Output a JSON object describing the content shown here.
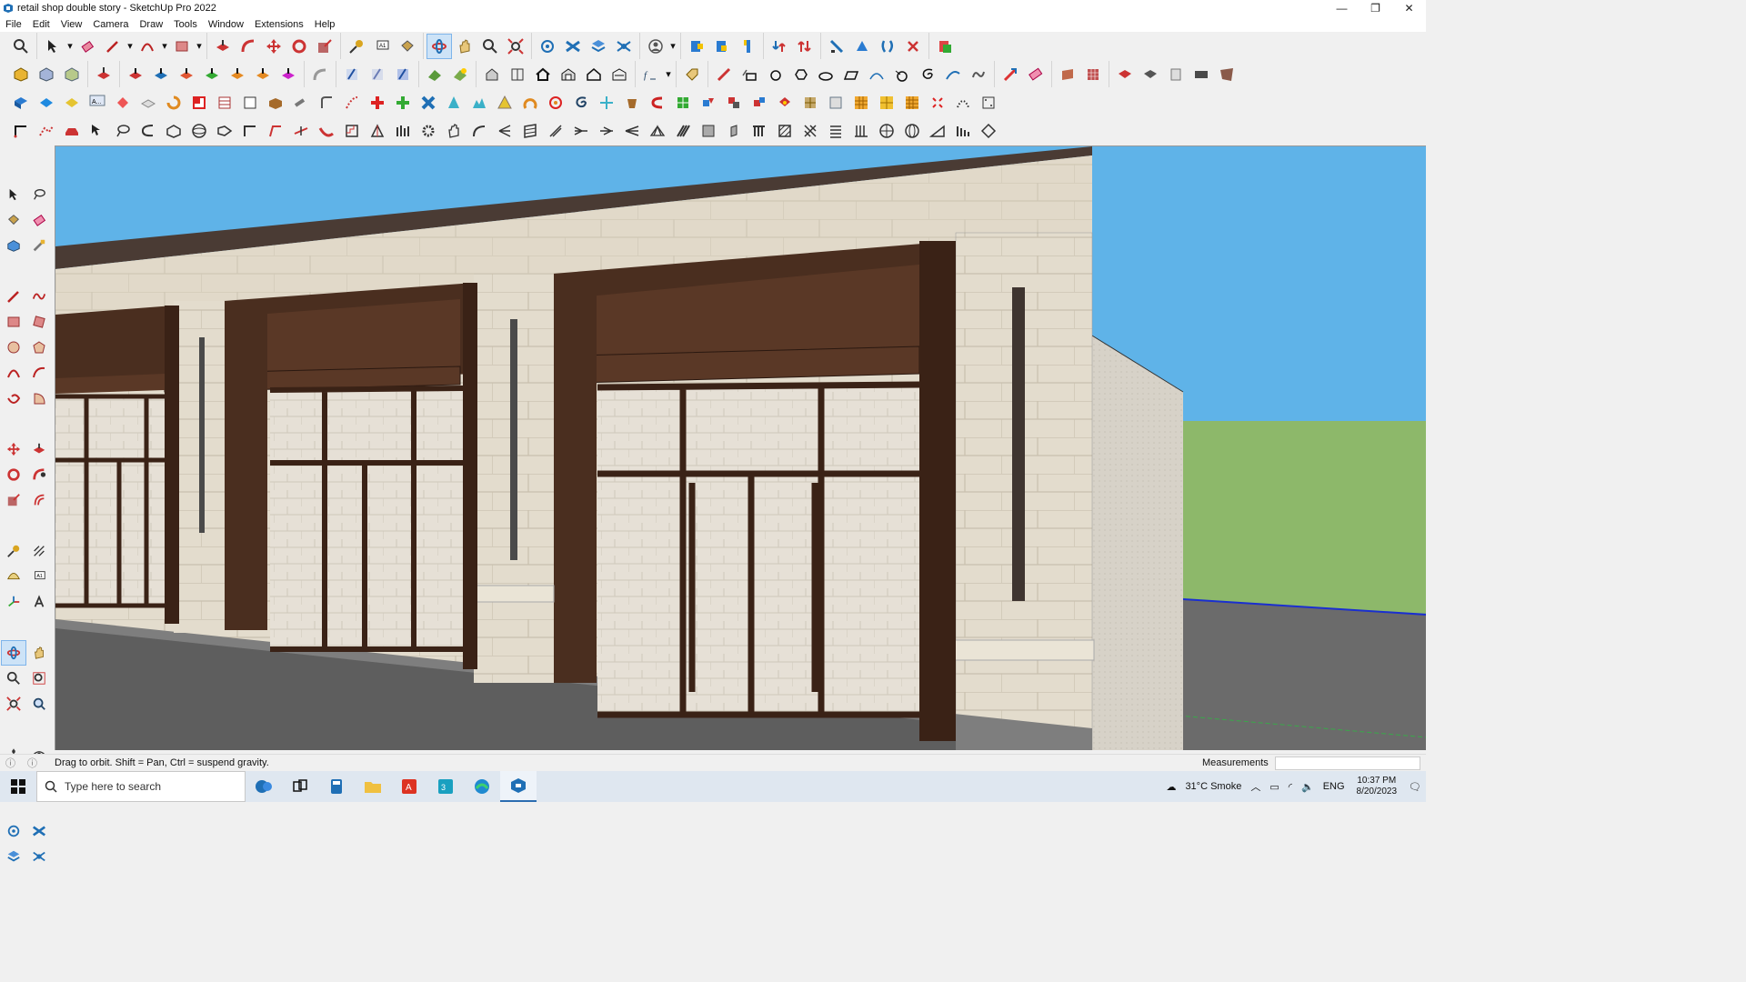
{
  "window": {
    "title": "retail shop double story - SketchUp Pro 2022",
    "minimize": "—",
    "restore": "❐",
    "close": "✕"
  },
  "menu": [
    "File",
    "Edit",
    "View",
    "Camera",
    "Draw",
    "Tools",
    "Window",
    "Extensions",
    "Help"
  ],
  "status": {
    "hint": "Drag to orbit. Shift = Pan, Ctrl = suspend gravity.",
    "measurements_label": "Measurements",
    "measurements_value": ""
  },
  "taskbar": {
    "search_placeholder": "Type here to search",
    "weather": "31°C  Smoke",
    "language": "ENG",
    "time": "10:37 PM",
    "date": "8/20/2023"
  },
  "colors": {
    "sky": "#5fb3e8",
    "grass": "#8db86a",
    "stone": "#e4ddd0",
    "wood": "#4a2e1f",
    "road": "#6b6b6b"
  }
}
